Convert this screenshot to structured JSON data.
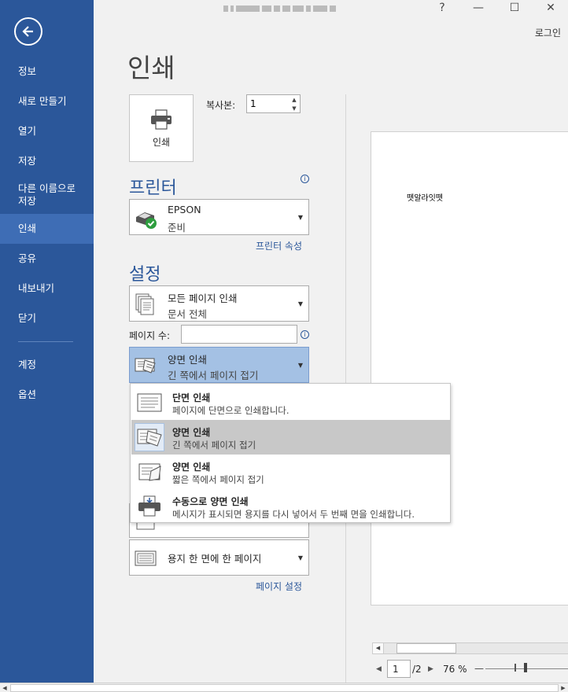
{
  "sidebar": {
    "items": [
      {
        "label": "정보"
      },
      {
        "label": "새로 만들기"
      },
      {
        "label": "열기"
      },
      {
        "label": "저장"
      },
      {
        "label": "다른 이름으로 저장"
      },
      {
        "label": "인쇄"
      },
      {
        "label": "공유"
      },
      {
        "label": "내보내기"
      },
      {
        "label": "닫기"
      },
      {
        "label": "계정"
      },
      {
        "label": "옵션"
      }
    ]
  },
  "titlebar": {
    "help": "?",
    "minimize": "—",
    "maximize": "☐",
    "close": "✕",
    "login": "로그인"
  },
  "page": {
    "title": "인쇄"
  },
  "print": {
    "button_label": "인쇄",
    "copies_label": "복사본:",
    "copies_value": "1"
  },
  "printer": {
    "section_title": "프린터",
    "name": "EPSON",
    "status": "준비",
    "properties_link": "프린터 속성"
  },
  "settings": {
    "section_title": "설정",
    "range_title": "모든 페이지 인쇄",
    "range_sub": "문서 전체",
    "pages_label": "페이지 수:",
    "pages_value": "",
    "duplex_title": "양면 인쇄",
    "duplex_sub": "긴 쪽에서 페이지 접기",
    "per_sheet": "용지 한 면에 한 페이지",
    "page_setup_link": "페이지 설정"
  },
  "duplex_menu": {
    "options": [
      {
        "title": "단면 인쇄",
        "desc": "페이지에 단면으로 인쇄합니다."
      },
      {
        "title": "양면 인쇄",
        "desc": "긴 쪽에서 페이지 접기"
      },
      {
        "title": "양면 인쇄",
        "desc": "짧은 쪽에서 페이지 접기"
      },
      {
        "title": "수동으로 양면 인쇄",
        "desc": "메시지가 표시되면 용지를 다시 넣어서 두 번째 면을 인쇄합니다."
      }
    ],
    "selected_index": 1
  },
  "preview": {
    "text": "뗏알라잇뗏",
    "current_page": "1",
    "total_pages": "/2",
    "zoom": "76 %"
  },
  "colors": {
    "sidebar": "#2b579a",
    "sidebar_active": "#3e6db5",
    "accent": "#2b579a",
    "selected_dropdown": "#a4c1e4"
  }
}
